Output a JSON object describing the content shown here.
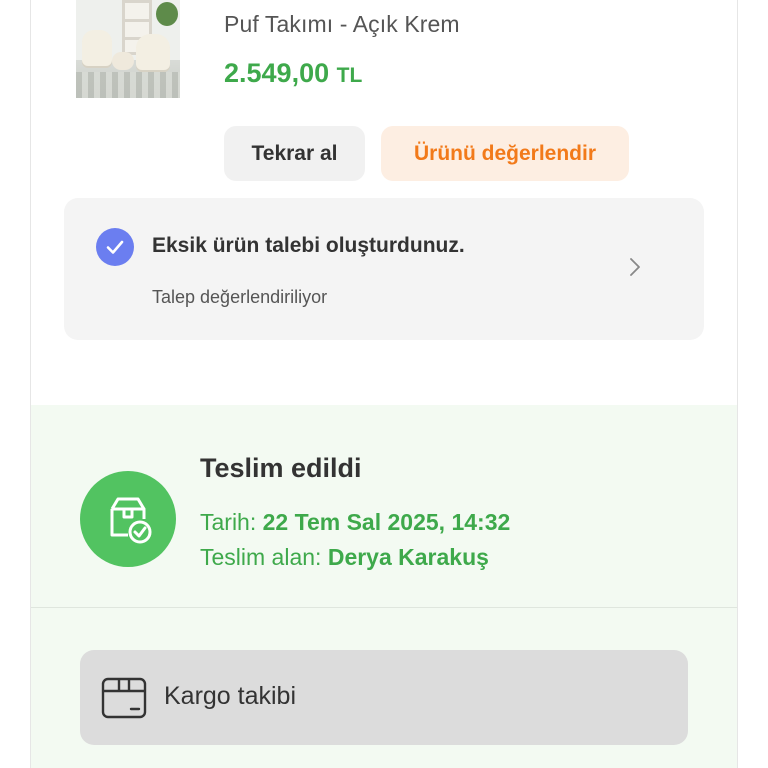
{
  "product": {
    "title_line": "Puf Takımı - Açık Krem",
    "price": "2.549,00",
    "currency": "TL",
    "image_icon": "product-photo-armchair-set"
  },
  "actions": {
    "rebuy_label": "Tekrar al",
    "review_label": "Ürünü değerlendir"
  },
  "claim": {
    "title": "Eksik ürün talebi oluşturdunuz.",
    "status": "Talep değerlendiriliyor",
    "icon": "check-circle-icon",
    "chevron": "chevron-right-icon"
  },
  "delivery": {
    "title": "Teslim edildi",
    "date_label": "Tarih:",
    "date_value": "22 Tem Sal 2025, 14:32",
    "receiver_label": "Teslim alan:",
    "receiver_value": "Derya Karakuş",
    "icon": "package-delivered-icon"
  },
  "cargo": {
    "label": "Kargo takibi",
    "icon": "box-icon"
  },
  "colors": {
    "accent_orange": "#f27a1a",
    "price_green": "#3ea94b",
    "delivered_green": "#52c361",
    "check_blue": "#6b7ef0"
  }
}
